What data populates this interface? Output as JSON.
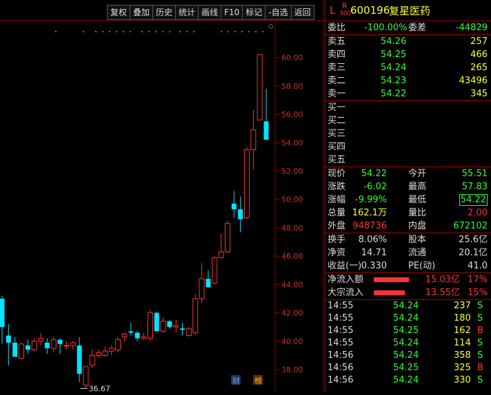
{
  "toolbar": [
    "复权",
    "叠加",
    "历史",
    "统计",
    "画线",
    "F10",
    "标记",
    "-自选",
    "返回"
  ],
  "header": {
    "market_flag": "L",
    "r_label": "R",
    "r_num": "300",
    "code": "600196",
    "name": "复星医药"
  },
  "entrust": {
    "label1": "委比",
    "value1": "-100.00%",
    "label2": "委差",
    "value2": "-44829"
  },
  "asks": [
    {
      "label": "卖五",
      "price": "54.26",
      "vol": "257"
    },
    {
      "label": "卖四",
      "price": "54.25",
      "vol": "466"
    },
    {
      "label": "卖三",
      "price": "54.24",
      "vol": "265"
    },
    {
      "label": "卖二",
      "price": "54.23",
      "vol": "43496"
    },
    {
      "label": "卖一",
      "price": "54.22",
      "vol": "345"
    }
  ],
  "bids": [
    {
      "label": "买一"
    },
    {
      "label": "买二"
    },
    {
      "label": "买三"
    },
    {
      "label": "买四"
    },
    {
      "label": "买五"
    }
  ],
  "quote": [
    {
      "l1": "现价",
      "v1": "54.22",
      "c1": "grn",
      "l2": "今开",
      "v2": "55.51",
      "c2": "grn"
    },
    {
      "l1": "涨跌",
      "v1": "-6.02",
      "c1": "grn",
      "l2": "最高",
      "v2": "57.83",
      "c2": "grn"
    },
    {
      "l1": "涨幅",
      "v1": "-9.99%",
      "c1": "grn",
      "l2": "最低",
      "v2": "54.22",
      "c2": "grn"
    },
    {
      "l1": "总量",
      "v1": "162.1万",
      "c1": "yel",
      "l2": "量比",
      "v2": "2.00",
      "c2": "red"
    },
    {
      "l1": "外盘",
      "v1": "948736",
      "c1": "red",
      "l2": "内盘",
      "v2": "672102",
      "c2": "grn"
    }
  ],
  "stats": [
    {
      "l1": "换手",
      "v1": "8.06%",
      "l2": "股本",
      "v2": "25.6亿"
    },
    {
      "l1": "净资",
      "v1": "14.71",
      "l2": "流通",
      "v2": "20.1亿"
    },
    {
      "l1": "收益(一)",
      "v1": "0.330",
      "l2": "PE(动)",
      "v2": "41.0"
    }
  ],
  "flows": [
    {
      "label": "净流入额",
      "amount": "15.03亿",
      "pct": "17%",
      "bar": 0.85
    },
    {
      "label": "大宗流入",
      "amount": "13.55亿",
      "pct": "15%",
      "bar": 0.75
    }
  ],
  "ticks": [
    {
      "time": "14:55",
      "price": "54.24",
      "vol": "237",
      "side": "S"
    },
    {
      "time": "14:55",
      "price": "54.24",
      "vol": "180",
      "side": "S"
    },
    {
      "time": "14:55",
      "price": "54.25",
      "vol": "162",
      "side": "B"
    },
    {
      "time": "14:55",
      "price": "54.24",
      "vol": "114",
      "side": "S"
    },
    {
      "time": "14:56",
      "price": "54.24",
      "vol": "358",
      "side": "S"
    },
    {
      "time": "14:56",
      "price": "54.25",
      "vol": "325",
      "side": "B"
    },
    {
      "time": "14:56",
      "price": "54.24",
      "vol": "330",
      "side": "S"
    }
  ],
  "chart_labels": {
    "low_marker": "36.67",
    "badge1": "财",
    "badge2": "榜"
  },
  "chart_data": {
    "type": "candlestick",
    "ylim": [
      36.4,
      62.6
    ],
    "y_ticks": [
      38,
      40,
      42,
      44,
      46,
      48,
      50,
      52,
      54,
      56,
      58,
      60
    ],
    "y_tick_labels": [
      "38.00",
      "40.00",
      "42.00",
      "44.00",
      "46.00",
      "48.00",
      "50.00",
      "52.00",
      "54.00",
      "56.00",
      "58.00",
      "60.00"
    ],
    "candles": [
      {
        "o": 43.0,
        "h": 43.2,
        "l": 39.8,
        "c": 41.0
      },
      {
        "o": 40.4,
        "h": 41.2,
        "l": 38.3,
        "c": 39.9
      },
      {
        "o": 39.9,
        "h": 40.3,
        "l": 38.9,
        "c": 38.9
      },
      {
        "o": 38.8,
        "h": 39.9,
        "l": 38.7,
        "c": 39.8
      },
      {
        "o": 39.7,
        "h": 40.1,
        "l": 39.1,
        "c": 39.4
      },
      {
        "o": 39.4,
        "h": 40.2,
        "l": 39.3,
        "c": 40.0
      },
      {
        "o": 40.0,
        "h": 40.6,
        "l": 39.7,
        "c": 40.2
      },
      {
        "o": 39.9,
        "h": 40.2,
        "l": 39.1,
        "c": 39.5
      },
      {
        "o": 39.5,
        "h": 40.3,
        "l": 39.2,
        "c": 40.1
      },
      {
        "o": 40.1,
        "h": 40.2,
        "l": 39.1,
        "c": 39.8
      },
      {
        "o": 39.7,
        "h": 40.0,
        "l": 39.4,
        "c": 39.7
      },
      {
        "o": 39.7,
        "h": 40.0,
        "l": 39.4,
        "c": 39.9
      },
      {
        "o": 39.7,
        "h": 40.3,
        "l": 37.1,
        "c": 37.7
      },
      {
        "o": 36.9,
        "h": 37.8,
        "l": 36.67,
        "c": 38.2
      },
      {
        "o": 38.3,
        "h": 39.4,
        "l": 38.1,
        "c": 39.0
      },
      {
        "o": 39.0,
        "h": 39.4,
        "l": 38.8,
        "c": 39.2
      },
      {
        "o": 39.0,
        "h": 39.6,
        "l": 38.9,
        "c": 39.3
      },
      {
        "o": 39.3,
        "h": 39.7,
        "l": 39.0,
        "c": 39.5
      },
      {
        "o": 39.4,
        "h": 40.3,
        "l": 39.2,
        "c": 40.1
      },
      {
        "o": 40.3,
        "h": 40.6,
        "l": 40.0,
        "c": 40.5
      },
      {
        "o": 40.7,
        "h": 41.3,
        "l": 40.4,
        "c": 40.6
      },
      {
        "o": 40.6,
        "h": 40.7,
        "l": 40.0,
        "c": 40.2
      },
      {
        "o": 40.2,
        "h": 40.6,
        "l": 40.1,
        "c": 40.3
      },
      {
        "o": 40.2,
        "h": 42.2,
        "l": 40.0,
        "c": 42.0
      },
      {
        "o": 42.0,
        "h": 42.1,
        "l": 40.7,
        "c": 40.7
      },
      {
        "o": 40.7,
        "h": 41.7,
        "l": 40.6,
        "c": 41.4
      },
      {
        "o": 41.4,
        "h": 41.5,
        "l": 40.9,
        "c": 41.0
      },
      {
        "o": 41.0,
        "h": 41.5,
        "l": 40.6,
        "c": 41.1
      },
      {
        "o": 40.9,
        "h": 41.3,
        "l": 40.4,
        "c": 40.8
      },
      {
        "o": 40.4,
        "h": 41.0,
        "l": 40.3,
        "c": 40.9
      },
      {
        "o": 40.6,
        "h": 43.3,
        "l": 40.4,
        "c": 43.0
      },
      {
        "o": 43.0,
        "h": 45.5,
        "l": 42.7,
        "c": 44.4
      },
      {
        "o": 44.4,
        "h": 45.0,
        "l": 43.8,
        "c": 43.8
      },
      {
        "o": 44.1,
        "h": 46.0,
        "l": 44.0,
        "c": 45.9
      },
      {
        "o": 45.9,
        "h": 47.6,
        "l": 45.8,
        "c": 46.3
      },
      {
        "o": 46.3,
        "h": 48.5,
        "l": 46.2,
        "c": 48.3
      },
      {
        "o": 49.7,
        "h": 50.6,
        "l": 48.7,
        "c": 49.3
      },
      {
        "o": 49.3,
        "h": 50.2,
        "l": 47.7,
        "c": 48.6
      },
      {
        "o": 48.7,
        "h": 53.7,
        "l": 48.6,
        "c": 53.5
      },
      {
        "o": 53.5,
        "h": 56.3,
        "l": 52.1,
        "c": 54.9
      },
      {
        "o": 55.6,
        "h": 60.2,
        "l": 55.6,
        "c": 60.2
      },
      {
        "o": 55.5,
        "h": 57.8,
        "l": 54.2,
        "c": 54.2
      }
    ]
  }
}
